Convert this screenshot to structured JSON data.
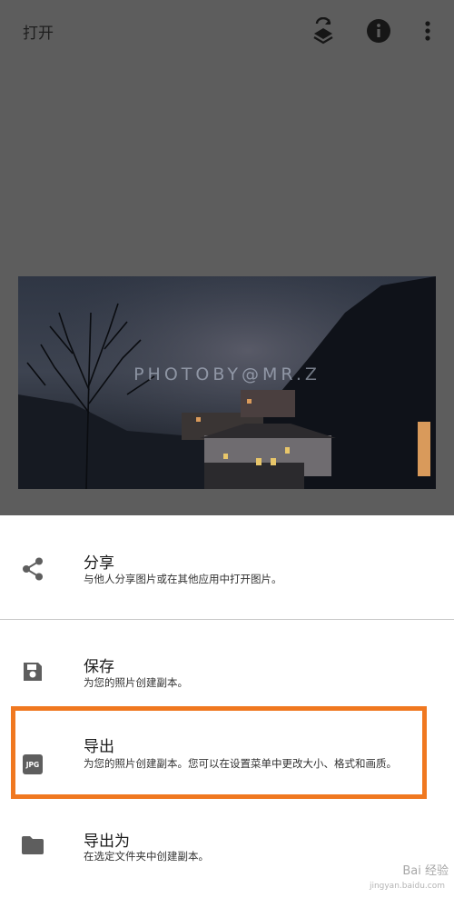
{
  "appbar": {
    "open_label": "打开",
    "icons": [
      "layers-refresh-icon",
      "info-icon",
      "more-vert-icon"
    ]
  },
  "photo": {
    "watermark": "PHOTOBY@MR.Z"
  },
  "menu": {
    "share": {
      "title": "分享",
      "desc": "与他人分享图片或在其他应用中打开图片。",
      "icon": "share-icon"
    },
    "save": {
      "title": "保存",
      "desc": "为您的照片创建副本。",
      "icon": "floppy-disk-icon"
    },
    "export": {
      "title": "导出",
      "desc": "为您的照片创建副本。您可以在设置菜单中更改大小、格式和画质。",
      "icon": "jpg-icon",
      "badge": "JPG"
    },
    "export_as": {
      "title": "导出为",
      "desc": "在选定文件夹中创建副本。",
      "icon": "folder-icon"
    }
  },
  "source_watermark": {
    "brand": "Bai 经验",
    "url": "jingyan.baidu.com"
  },
  "colors": {
    "overlay": "#5d5d5d",
    "highlight": "#f07820",
    "icon": "#5e5e5e"
  }
}
